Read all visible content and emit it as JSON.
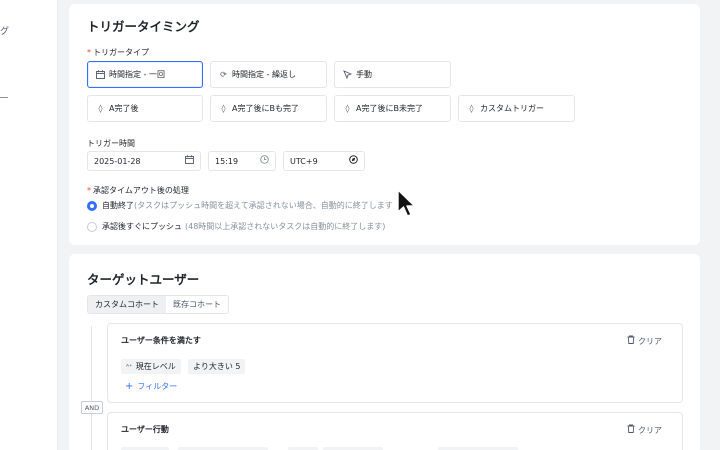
{
  "sidebar": {
    "fragment": "グ"
  },
  "trigger_timing": {
    "title": "トリガータイミング",
    "type_label": "トリガータイプ",
    "types": [
      {
        "label": "時間指定 - 一回",
        "icon": "calendar-icon",
        "selected": true
      },
      {
        "label": "時間指定 - 繰返し",
        "icon": "repeat-icon",
        "selected": false
      },
      {
        "label": "手動",
        "icon": "pointer-icon",
        "selected": false
      },
      {
        "label": "A完了後",
        "icon": "diamond-icon",
        "selected": false
      },
      {
        "label": "A完了後にBも完了",
        "icon": "diamond-icon",
        "selected": false
      },
      {
        "label": "A完了後にB未完了",
        "icon": "diamond-icon",
        "selected": false
      },
      {
        "label": "カスタムトリガー",
        "icon": "diamond-icon",
        "selected": false
      }
    ],
    "time_label": "トリガー時間",
    "date_value": "2025-01-28",
    "time_value": "15:19",
    "timezone_value": "UTC+9",
    "timeout_label": "承認タイムアウト後の処理",
    "timeout_options": [
      {
        "label": "自動終了",
        "hint": "(タスクはプッシュ時間を超えて承認されない場合、自動的に終了します",
        "selected": true
      },
      {
        "label": "承認後すぐにプッシュ",
        "hint": "(48時間以上承認されないタスクは自動的に終了します)",
        "selected": false
      }
    ]
  },
  "target_users": {
    "title": "ターゲットユーザー",
    "tabs": [
      "カスタムコホート",
      "既存コホート"
    ],
    "active_tab": 0,
    "condition_block": {
      "title": "ユーザー条件を満たす",
      "clear_label": "クリア",
      "chips": [
        "現在レベル",
        "より大きい  5"
      ],
      "add_filter_label": "フィルター"
    },
    "logic_label": "AND",
    "behavior_block": {
      "title": "ユーザー行動",
      "clear_label": "クリア"
    }
  },
  "colors": {
    "accent": "#3370ff",
    "required": "#f53f3f",
    "border": "#e5e6eb",
    "background": "#f2f3f5"
  }
}
